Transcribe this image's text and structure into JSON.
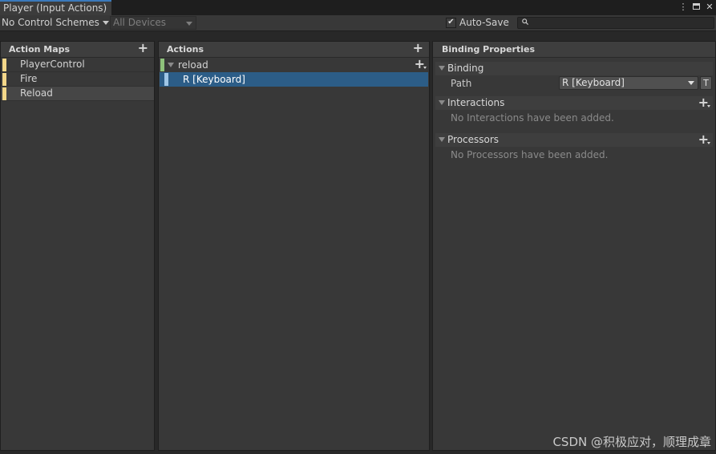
{
  "window": {
    "tab_title": "Player (Input Actions)",
    "more_icon": "⋮",
    "close_icon": "✕"
  },
  "toolbar": {
    "control_scheme": "No Control Schemes",
    "devices": "All Devices",
    "auto_save_label": "Auto-Save",
    "auto_save_checked": "✔",
    "search_placeholder": "",
    "search_icon": "🔍"
  },
  "action_maps": {
    "header": "Action Maps",
    "add_icon": "+",
    "items": [
      {
        "label": "PlayerControl",
        "color": "#f3d789"
      },
      {
        "label": "Fire",
        "color": "#f3d789"
      },
      {
        "label": "Reload",
        "color": "#f3d789",
        "selected": true
      }
    ]
  },
  "actions": {
    "header": "Actions",
    "add_icon": "+",
    "items": [
      {
        "label": "reload",
        "color": "#8ec27b",
        "add_icon": "+",
        "bindings": [
          {
            "label": "R [Keyboard]",
            "color": "#9fc6e6",
            "selected": true
          }
        ]
      }
    ]
  },
  "binding_properties": {
    "header": "Binding Properties",
    "binding_section": "Binding",
    "path_label": "Path",
    "path_value": "R [Keyboard]",
    "t_button": "T",
    "interactions_section": "Interactions",
    "interactions_empty": "No Interactions have been added.",
    "processors_section": "Processors",
    "processors_empty": "No Processors have been added.",
    "add_icon": "+"
  },
  "watermark": "CSDN @积极应对，顺理成章",
  "colors": {
    "accent_selected": "#2c5d87",
    "tab_accent": "#3a79bb",
    "map_color": "#f3d789",
    "action_color": "#8ec27b",
    "binding_color": "#9fc6e6"
  }
}
